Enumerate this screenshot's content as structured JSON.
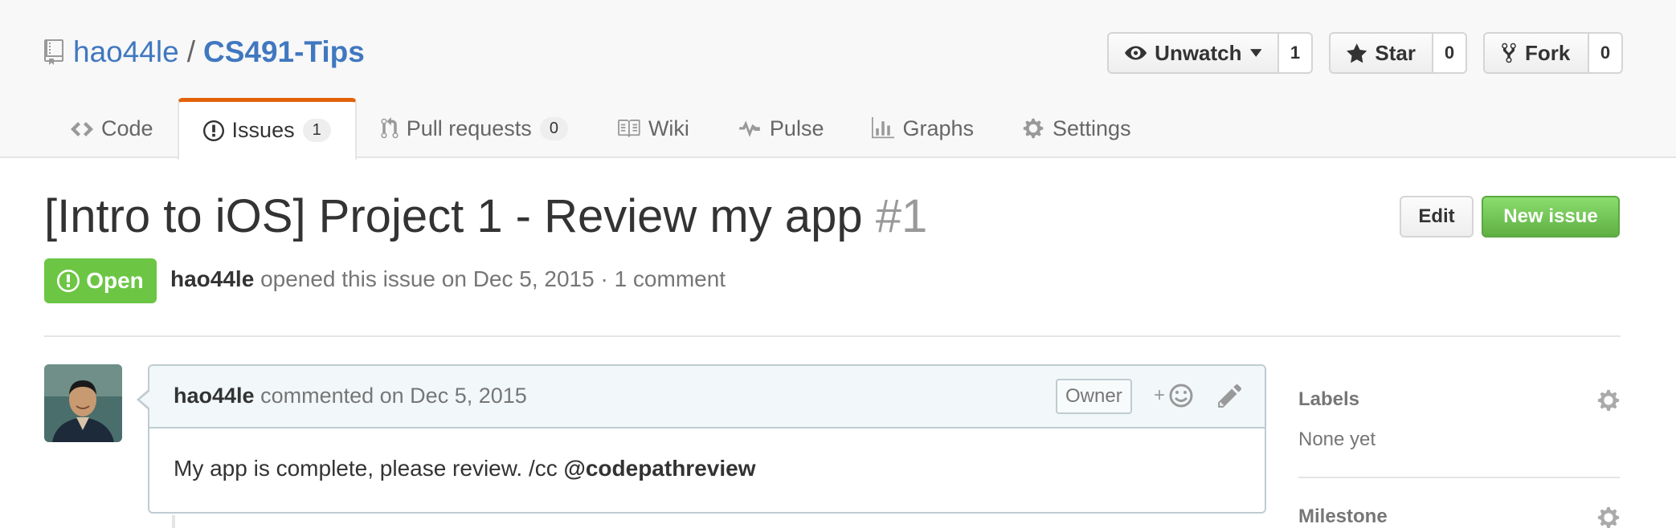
{
  "repo": {
    "owner": "hao44le",
    "separator": "/",
    "name": "CS491-Tips"
  },
  "actions": {
    "watch": {
      "label": "Unwatch",
      "count": "1"
    },
    "star": {
      "label": "Star",
      "count": "0"
    },
    "fork": {
      "label": "Fork",
      "count": "0"
    }
  },
  "nav": {
    "code": "Code",
    "issues": "Issues",
    "issues_count": "1",
    "pulls": "Pull requests",
    "pulls_count": "0",
    "wiki": "Wiki",
    "pulse": "Pulse",
    "graphs": "Graphs",
    "settings": "Settings"
  },
  "issue": {
    "title": "[Intro to iOS] Project 1 - Review my app",
    "number": "#1",
    "state": "Open",
    "author": "hao44le",
    "meta_text": "opened this issue on Dec 5, 2015 · 1 comment",
    "edit_label": "Edit",
    "new_issue_label": "New issue"
  },
  "comment": {
    "author": "hao44le",
    "header_text": "commented on Dec 5, 2015",
    "owner_label": "Owner",
    "body_text": "My app is complete, please review. /cc ",
    "mention": "@codepathreview"
  },
  "sidebar": {
    "labels_heading": "Labels",
    "labels_value": "None yet",
    "milestone_heading": "Milestone"
  },
  "colors": {
    "link": "#4078c0",
    "open_green": "#6cc644",
    "nav_accent": "#e36209"
  },
  "icons": [
    "repo-icon",
    "eye-icon",
    "triangle-down-icon",
    "star-icon",
    "repo-forked-icon",
    "code-icon",
    "issue-opened-icon",
    "git-pull-request-icon",
    "book-icon",
    "pulse-icon",
    "graph-icon",
    "gear-icon",
    "smiley-icon",
    "pencil-icon"
  ]
}
